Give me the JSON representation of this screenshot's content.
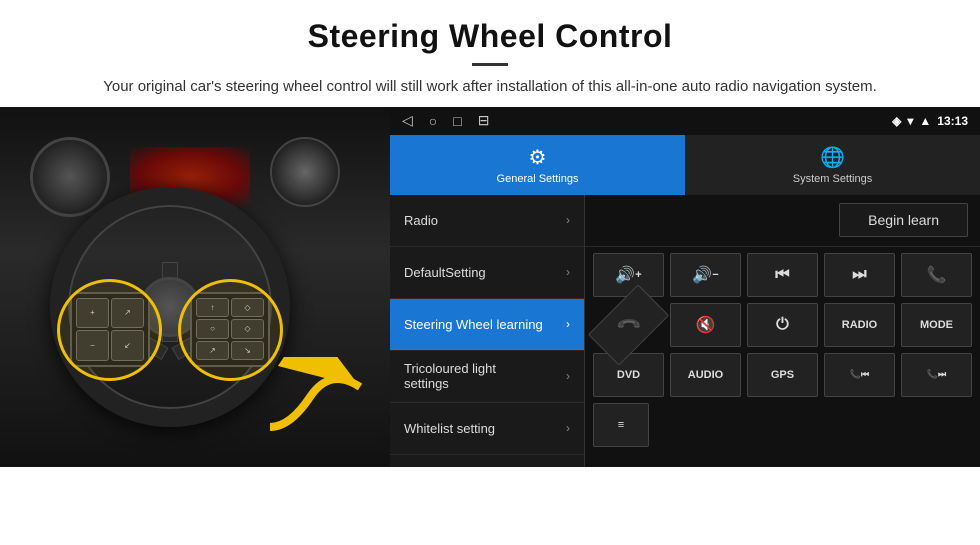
{
  "header": {
    "title": "Steering Wheel Control",
    "subtitle": "Your original car's steering wheel control will still work after installation of this all-in-one auto radio navigation system."
  },
  "status_bar": {
    "time": "13:13",
    "nav_icons": [
      "◁",
      "○",
      "□",
      "⊟"
    ]
  },
  "tabs": [
    {
      "label": "General Settings",
      "icon": "⚙",
      "active": true
    },
    {
      "label": "System Settings",
      "icon": "🌐",
      "active": false
    }
  ],
  "menu_items": [
    {
      "label": "Radio",
      "active": false
    },
    {
      "label": "DefaultSetting",
      "active": false
    },
    {
      "label": "Steering Wheel learning",
      "active": true
    },
    {
      "label": "Tricoloured light settings",
      "active": false,
      "multiline": true
    },
    {
      "label": "Whitelist setting",
      "active": false
    }
  ],
  "begin_learn_label": "Begin learn",
  "control_buttons": {
    "row1": [
      "🔊+",
      "🔊−",
      "⏮",
      "⏭",
      "📞"
    ],
    "row2": [
      "📞",
      "🔇",
      "⏻",
      "RADIO",
      "MODE"
    ],
    "row3": [
      "DVD",
      "AUDIO",
      "GPS",
      "📞⏮",
      "📞⏭"
    ]
  },
  "whitelist_icon": "≡"
}
